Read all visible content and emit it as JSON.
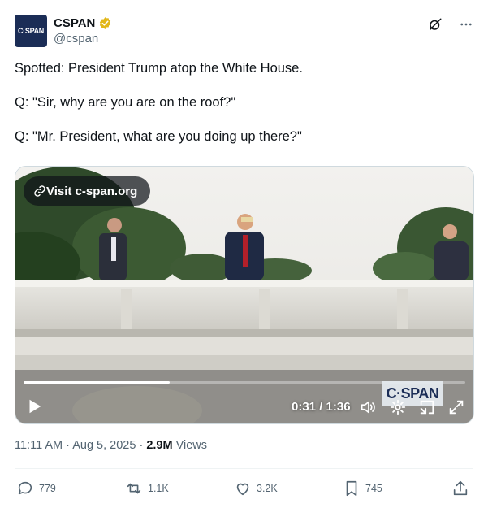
{
  "author": {
    "avatar_text": "C·SPAN",
    "display_name": "CSPAN",
    "handle": "@cspan",
    "verified_color": "#e2b719"
  },
  "tweet": {
    "lines": [
      "Spotted: President Trump atop the White House.",
      "Q: \"Sir, why are you are on the roof?\"",
      "Q: \"Mr. President, what are you doing up there?\""
    ]
  },
  "media": {
    "visit_label": "Visit c-span.org",
    "logo_text": "C·SPAN",
    "time_display": "0:31 / 1:36",
    "progress_fraction": 0.33
  },
  "meta": {
    "time": "11:11 AM",
    "date": "Aug 5, 2025",
    "views_count": "2.9M",
    "views_label": "Views"
  },
  "stats": {
    "replies": "779",
    "reposts": "1.1K",
    "likes": "3.2K",
    "bookmarks": "745"
  },
  "icons": {
    "header": [
      "grok-icon",
      "more-icon"
    ],
    "actions": [
      "reply-icon",
      "repost-icon",
      "like-icon",
      "bookmark-icon",
      "share-icon"
    ]
  }
}
